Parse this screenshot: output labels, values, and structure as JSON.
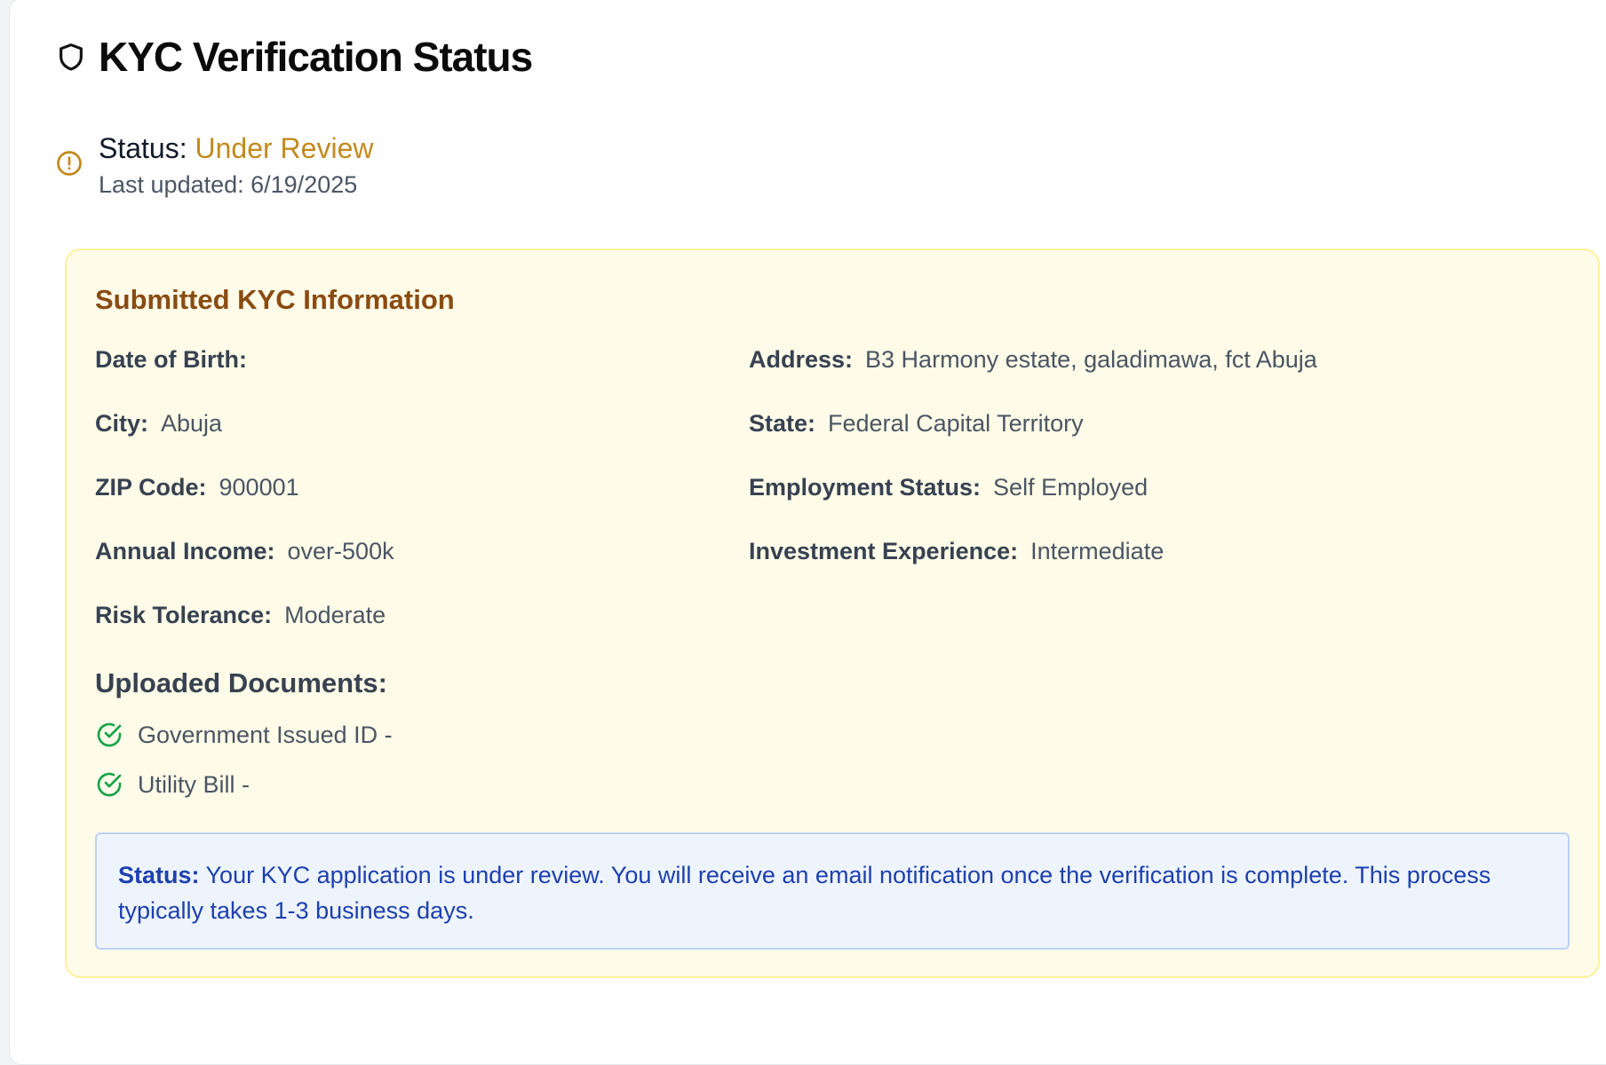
{
  "header": {
    "title": "KYC Verification Status",
    "icon": "shield-icon"
  },
  "status": {
    "label": "Status:",
    "value": "Under Review",
    "value_color": "#c28a1e",
    "last_updated": "Last updated: 6/19/2025",
    "icon": "alert-circle-icon"
  },
  "kyc_info": {
    "title": "Submitted KYC Information",
    "fields": {
      "dob": {
        "label": "Date of Birth:",
        "value": ""
      },
      "address": {
        "label": "Address:",
        "value": "B3 Harmony estate, galadimawa, fct Abuja"
      },
      "city": {
        "label": "City:",
        "value": "Abuja"
      },
      "state": {
        "label": "State:",
        "value": "Federal Capital Territory"
      },
      "zip": {
        "label": "ZIP Code:",
        "value": "900001"
      },
      "employment": {
        "label": "Employment Status:",
        "value": "Self Employed"
      },
      "income": {
        "label": "Annual Income:",
        "value": "over-500k"
      },
      "experience": {
        "label": "Investment Experience:",
        "value": "Intermediate"
      },
      "risk": {
        "label": "Risk Tolerance:",
        "value": "Moderate"
      }
    }
  },
  "documents": {
    "title": "Uploaded Documents:",
    "items": [
      {
        "label": "Government Issued ID -",
        "icon": "check-circle-icon"
      },
      {
        "label": "Utility Bill -",
        "icon": "check-circle-icon"
      }
    ]
  },
  "notice": {
    "label": "Status:",
    "text": "Your KYC application is under review. You will receive an email notification once the verification is complete. This process typically takes 1-3 business days."
  },
  "colors": {
    "panel_bg": "#fefce8",
    "panel_border": "#fdf09a",
    "section_title": "#8a4b12",
    "notice_bg": "#eef4fd",
    "notice_text": "#1e40af",
    "check_green": "#16a34a"
  }
}
